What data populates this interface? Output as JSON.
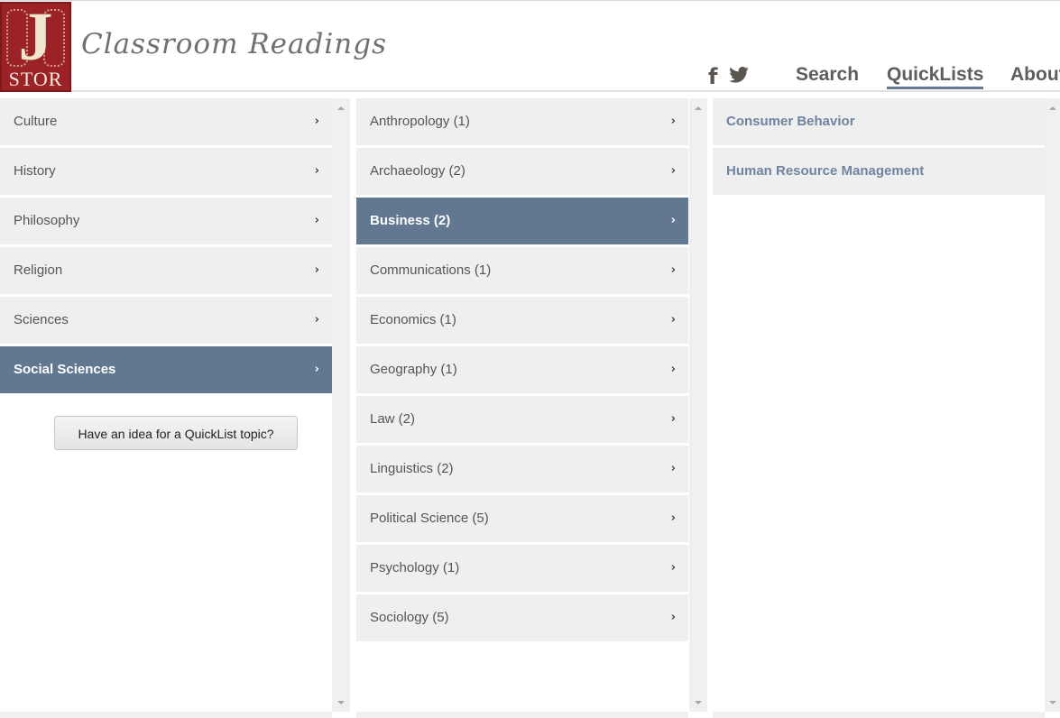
{
  "header": {
    "logo_text": "J",
    "logo_subtext": "STOR",
    "brand": "Classroom Readings",
    "social": [
      {
        "name": "facebook-icon",
        "glyph": "f"
      },
      {
        "name": "twitter-icon",
        "glyph": "twitter"
      }
    ],
    "nav": [
      {
        "label": "Search",
        "active": false
      },
      {
        "label": "QuickLists",
        "active": true
      },
      {
        "label": "About",
        "active": false
      }
    ]
  },
  "colors": {
    "accent": "#627891",
    "item_bg": "#efefef",
    "logo_red": "#9b2226",
    "link_blue": "#6e84a0"
  },
  "columns": {
    "disciplines": [
      {
        "label": "Culture",
        "selected": false
      },
      {
        "label": "History",
        "selected": false
      },
      {
        "label": "Philosophy",
        "selected": false
      },
      {
        "label": "Religion",
        "selected": false
      },
      {
        "label": "Sciences",
        "selected": false
      },
      {
        "label": "Social Sciences",
        "selected": true
      }
    ],
    "subjects": [
      {
        "label": "Anthropology (1)",
        "selected": false
      },
      {
        "label": "Archaeology (2)",
        "selected": false
      },
      {
        "label": "Business (2)",
        "selected": true
      },
      {
        "label": "Communications (1)",
        "selected": false
      },
      {
        "label": "Economics (1)",
        "selected": false
      },
      {
        "label": "Geography (1)",
        "selected": false
      },
      {
        "label": "Law (2)",
        "selected": false
      },
      {
        "label": "Linguistics (2)",
        "selected": false
      },
      {
        "label": "Political Science (5)",
        "selected": false
      },
      {
        "label": "Psychology (1)",
        "selected": false
      },
      {
        "label": "Sociology (5)",
        "selected": false
      }
    ],
    "quicklists": [
      {
        "label": "Consumer Behavior"
      },
      {
        "label": "Human Resource Management"
      }
    ]
  },
  "idea_button": "Have an idea for a QuickList topic?",
  "chevron_glyph": "›"
}
